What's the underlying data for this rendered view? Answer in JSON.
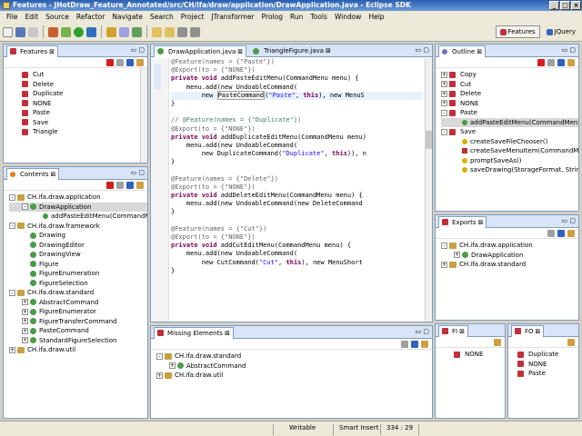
{
  "window": {
    "title": "Features - JHotDraw_Feature_Annotated/src/CH/ifa/draw/application/DrawApplication.java - Eclipse SDK"
  },
  "menu": [
    "File",
    "Edit",
    "Source",
    "Refactor",
    "Navigate",
    "Search",
    "Project",
    "JTransformer",
    "Prolog",
    "Run",
    "Tools",
    "Window",
    "Help"
  ],
  "perspectives": {
    "features": "Features",
    "jquery": "JQuery"
  },
  "features_view": {
    "title": "Features",
    "items": [
      "Cut",
      "Delete",
      "Duplicate",
      "NONE",
      "Paste",
      "Save",
      "Triangle"
    ]
  },
  "contents_view": {
    "title": "Contents",
    "rows": [
      {
        "label": "CH.ifa.draw.application",
        "type": "pkg",
        "indent": 0,
        "exp": "-"
      },
      {
        "label": "DrawApplication",
        "type": "cls",
        "indent": 1,
        "exp": "-",
        "sel": true
      },
      {
        "label": "addPasteEditMenu(CommandM",
        "type": "mth",
        "indent": 2,
        "exp": ""
      },
      {
        "label": "CH.ifa.draw.framework",
        "type": "pkg",
        "indent": 0,
        "exp": "-"
      },
      {
        "label": "Drawing",
        "type": "cls",
        "indent": 1,
        "exp": ""
      },
      {
        "label": "DrawingEditor",
        "type": "cls",
        "indent": 1,
        "exp": ""
      },
      {
        "label": "DrawingView",
        "type": "cls",
        "indent": 1,
        "exp": ""
      },
      {
        "label": "Figure",
        "type": "cls",
        "indent": 1,
        "exp": ""
      },
      {
        "label": "FigureEnumeration",
        "type": "cls",
        "indent": 1,
        "exp": ""
      },
      {
        "label": "FigureSelection",
        "type": "cls",
        "indent": 1,
        "exp": ""
      },
      {
        "label": "CH.ifa.draw.standard",
        "type": "pkg",
        "indent": 0,
        "exp": "-"
      },
      {
        "label": "AbstractCommand",
        "type": "cls",
        "indent": 1,
        "exp": "+"
      },
      {
        "label": "FigureEnumerator",
        "type": "cls",
        "indent": 1,
        "exp": "+"
      },
      {
        "label": "FigureTransferCommand",
        "type": "cls",
        "indent": 1,
        "exp": "+"
      },
      {
        "label": "PasteCommand",
        "type": "cls",
        "indent": 1,
        "exp": "+"
      },
      {
        "label": "StandardFigureSelection",
        "type": "cls",
        "indent": 1,
        "exp": "+"
      },
      {
        "label": "CH.ifa.draw.util",
        "type": "pkg",
        "indent": 0,
        "exp": "+"
      }
    ]
  },
  "editor": {
    "tabs": [
      {
        "label": "DrawApplication.java",
        "active": true
      },
      {
        "label": "TriangleFigure.java",
        "active": false
      }
    ],
    "lines": [
      [
        [
          "ann",
          "@Feature(names = {\"Paste\"})"
        ]
      ],
      [
        [
          "ann",
          "@Export(to = {\"NONE\"})"
        ]
      ],
      [
        [
          "kw",
          "private void "
        ],
        [
          "",
          "addPasteEditMenu(CommandMenu menu) {"
        ]
      ],
      [
        [
          "",
          "    menu.add(new UndoableCommand("
        ]
      ],
      [
        [
          "",
          "        new "
        ],
        [
          "box",
          "PasteCommand"
        ],
        [
          "",
          "("
        ],
        [
          "str",
          "\"Paste\""
        ],
        [
          "",
          ", "
        ],
        [
          "kw",
          "this"
        ],
        [
          "",
          "), new MenuS"
        ]
      ],
      [
        [
          "",
          "}"
        ]
      ],
      [
        [
          "",
          ""
        ]
      ],
      [
        [
          "cmt",
          "// @Feature(names = {\"Duplicate\"})"
        ]
      ],
      [
        [
          "ann",
          "@Export(to = {\"NONE\"})"
        ]
      ],
      [
        [
          "kw",
          "private void "
        ],
        [
          "",
          "addDuplicateEditMenu(CommandMenu menu)"
        ]
      ],
      [
        [
          "",
          "    menu.add(new UndoableCommand("
        ]
      ],
      [
        [
          "",
          "        new DuplicateCommand("
        ],
        [
          "str",
          "\"Duplicate\""
        ],
        [
          "",
          ", "
        ],
        [
          "kw",
          "this"
        ],
        [
          "",
          ")), n"
        ]
      ],
      [
        [
          "",
          "}"
        ]
      ],
      [
        [
          "",
          ""
        ]
      ],
      [
        [
          "ann",
          "@Feature(names = {\"Delete\"})"
        ]
      ],
      [
        [
          "ann",
          "@Export(to = {\"NONE\"})"
        ]
      ],
      [
        [
          "kw",
          "private void "
        ],
        [
          "",
          "addDeleteEditMenu(CommandMenu menu) {"
        ]
      ],
      [
        [
          "",
          "    menu.add(new UndoableCommand(new DeleteCommand"
        ]
      ],
      [
        [
          "",
          "}"
        ]
      ],
      [
        [
          "",
          ""
        ]
      ],
      [
        [
          "ann",
          "@Feature(names = {\"Cut\"})"
        ]
      ],
      [
        [
          "ann",
          "@Export(to = {\"NONE\"})"
        ]
      ],
      [
        [
          "kw",
          "private void "
        ],
        [
          "",
          "addCutEditMenu(CommandMenu menu) {"
        ]
      ],
      [
        [
          "",
          "    menu.add(new UndoableCommand("
        ]
      ],
      [
        [
          "",
          "        new CutCommand("
        ],
        [
          "str",
          "\"Cut\""
        ],
        [
          "",
          ", "
        ],
        [
          "kw",
          "this"
        ],
        [
          "",
          "), new MenuShort"
        ]
      ],
      [
        [
          "",
          "}"
        ]
      ]
    ]
  },
  "outline_view": {
    "title": "Outline",
    "rows": [
      {
        "label": "Copy",
        "type": "fic",
        "indent": 0,
        "exp": "+"
      },
      {
        "label": "Cut",
        "type": "fic",
        "indent": 0,
        "exp": "+"
      },
      {
        "label": "Delete",
        "type": "fic",
        "indent": 0,
        "exp": "+"
      },
      {
        "label": "NONE",
        "type": "fic",
        "indent": 0,
        "exp": "+"
      },
      {
        "label": "Paste",
        "type": "fic",
        "indent": 0,
        "exp": "-"
      },
      {
        "label": "addPasteEditMenu(CommandMen",
        "type": "mth",
        "indent": 1,
        "exp": "",
        "sel": true
      },
      {
        "label": "Save",
        "type": "fic",
        "indent": 0,
        "exp": "-"
      },
      {
        "label": "createSaveFileChooser()",
        "type": "mthy",
        "indent": 1,
        "exp": ""
      },
      {
        "label": "createSaveMenuItem(CommandM",
        "type": "mthr",
        "indent": 1,
        "exp": ""
      },
      {
        "label": "promptSaveAs()",
        "type": "mthy",
        "indent": 1,
        "exp": ""
      },
      {
        "label": "saveDrawing(StorageFormat, Strin",
        "type": "mthy",
        "indent": 1,
        "exp": ""
      }
    ]
  },
  "exports_view": {
    "title": "Exports",
    "rows": [
      {
        "label": "CH.ifa.draw.application",
        "type": "pkg",
        "indent": 0,
        "exp": "-"
      },
      {
        "label": "DrawApplication",
        "type": "cls",
        "indent": 1,
        "exp": "+"
      },
      {
        "label": "CH.ifa.draw.standard",
        "type": "pkg",
        "indent": 0,
        "exp": "+"
      }
    ]
  },
  "missing_view": {
    "title": "Missing Elements",
    "rows": [
      {
        "label": "CH.ifa.draw.standard",
        "type": "pkg",
        "indent": 0,
        "exp": "-"
      },
      {
        "label": "AbstractCommand",
        "type": "cls",
        "indent": 1,
        "exp": "+"
      },
      {
        "label": "CH.ifa.draw.util",
        "type": "pkg",
        "indent": 0,
        "exp": "+"
      }
    ]
  },
  "fi_view": {
    "title": "FI",
    "items": [
      "NONE"
    ]
  },
  "fo_view": {
    "title": "FO",
    "items": [
      "Duplicate",
      "NONE",
      "Paste"
    ]
  },
  "status": {
    "writable": "Writable",
    "insert": "Smart Insert",
    "position": "334 : 29"
  }
}
